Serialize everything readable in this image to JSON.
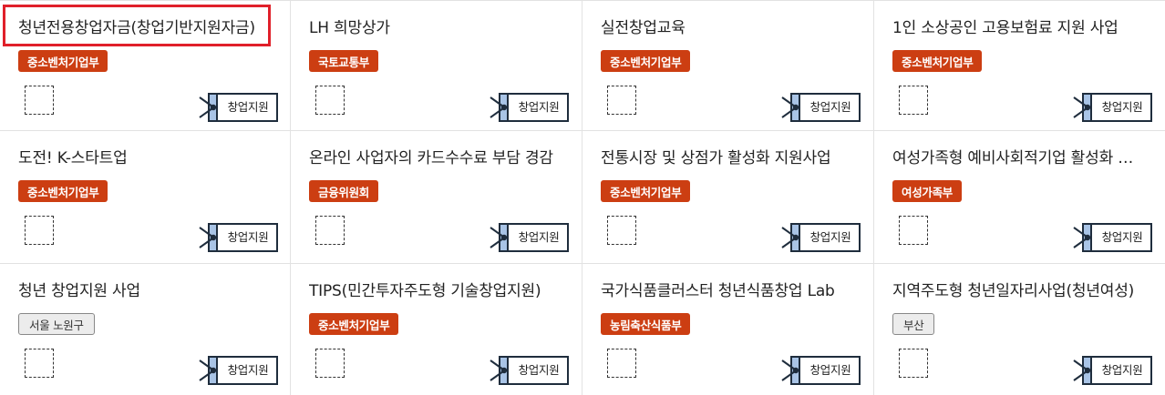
{
  "cards": [
    {
      "title": "청년전용창업자금(창업기반지원자금)",
      "badge": "중소벤처기업부",
      "badge_type": "ministry",
      "tag": "창업지원",
      "selected": true
    },
    {
      "title": "LH 희망상가",
      "badge": "국토교통부",
      "badge_type": "ministry",
      "tag": "창업지원"
    },
    {
      "title": "실전창업교육",
      "badge": "중소벤처기업부",
      "badge_type": "ministry",
      "tag": "창업지원"
    },
    {
      "title": "1인 소상공인 고용보험료 지원 사업",
      "badge": "중소벤처기업부",
      "badge_type": "ministry",
      "tag": "창업지원"
    },
    {
      "title": "도전! K-스타트업",
      "badge": "중소벤처기업부",
      "badge_type": "ministry",
      "tag": "창업지원"
    },
    {
      "title": "온라인 사업자의 카드수수료 부담 경감",
      "badge": "금융위원회",
      "badge_type": "ministry",
      "tag": "창업지원"
    },
    {
      "title": "전통시장 및 상점가 활성화 지원사업",
      "badge": "중소벤처기업부",
      "badge_type": "ministry",
      "tag": "창업지원"
    },
    {
      "title": "여성가족형 예비사회적기업 활성화 지원",
      "badge": "여성가족부",
      "badge_type": "ministry",
      "tag": "창업지원"
    },
    {
      "title": "청년 창업지원 사업",
      "badge": "서울 노원구",
      "badge_type": "region",
      "tag": "창업지원"
    },
    {
      "title": "TIPS(민간투자주도형 기술창업지원)",
      "badge": "중소벤처기업부",
      "badge_type": "ministry",
      "tag": "창업지원"
    },
    {
      "title": "국가식품클러스터 청년식품창업 Lab",
      "badge": "농림축산식품부",
      "badge_type": "ministry",
      "tag": "창업지원"
    },
    {
      "title": "지역주도형 청년일자리사업(청년여성)",
      "badge": "부산",
      "badge_type": "region",
      "tag": "창업지원"
    }
  ],
  "colors": {
    "ministry_badge": "#cc3e12",
    "selection_border": "#e0202a",
    "tag_blue": "#a9c4e6",
    "tag_dark": "#1f2d3d"
  }
}
